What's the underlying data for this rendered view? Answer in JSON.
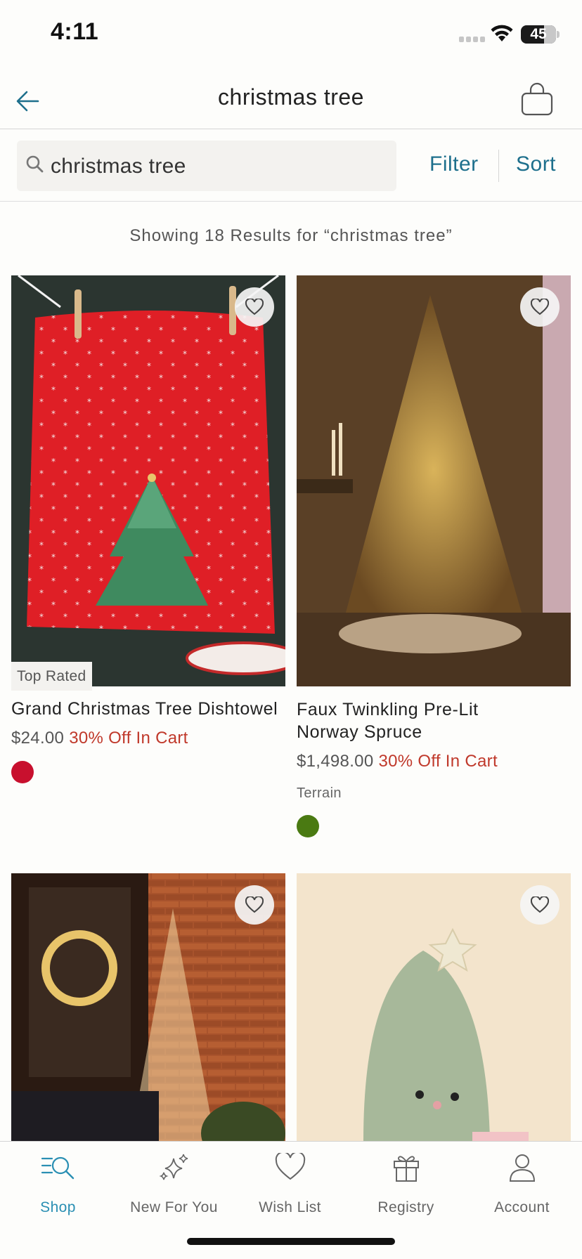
{
  "status_bar": {
    "time": "4:11",
    "battery": "45",
    "battery_level": 0.45
  },
  "header": {
    "title": "christmas tree"
  },
  "search": {
    "value": "christmas tree",
    "filter_label": "Filter",
    "sort_label": "Sort"
  },
  "results": {
    "summary": "Showing 18 Results for “christmas tree”"
  },
  "products": [
    {
      "name": "Grand Christmas Tree Dishtowel",
      "badge": "Top Rated",
      "price": "$24.00",
      "promo": "30% Off In Cart",
      "brand": "",
      "swatch_color": "#c8102e"
    },
    {
      "name_line1": "Faux Twinkling Pre-Lit",
      "name_line2": "Norway Spruce",
      "price": "$1,498.00",
      "promo": "30% Off In Cart",
      "brand": "Terrain",
      "swatch_color": "#4a7a12"
    },
    {
      "name": "",
      "image": "string-light-tree-on-brick-wall"
    },
    {
      "name": "",
      "image": "plush-green-tree-toy"
    }
  ],
  "tabs": [
    {
      "label": "Shop",
      "icon": "shop-search-icon",
      "active": true
    },
    {
      "label": "New For You",
      "icon": "sparkles-icon",
      "active": false
    },
    {
      "label": "Wish List",
      "icon": "heart-icon",
      "active": false
    },
    {
      "label": "Registry",
      "icon": "gift-icon",
      "active": false
    },
    {
      "label": "Account",
      "icon": "person-icon",
      "active": false
    }
  ],
  "colors": {
    "accent": "#1d6f8c",
    "tab_active": "#2a8fb3",
    "promo": "#c0392b"
  }
}
